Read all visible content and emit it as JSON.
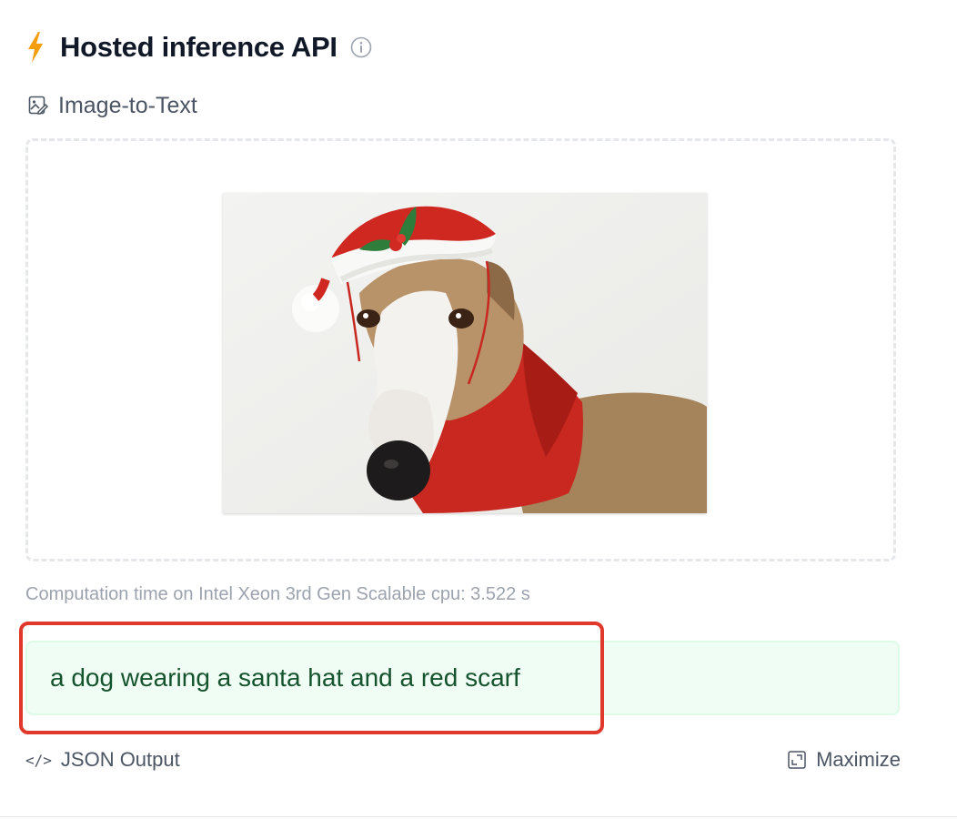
{
  "header": {
    "title": "Hosted inference API",
    "icon": "bolt-icon",
    "accent_color": "#f59e0b"
  },
  "task": {
    "label": "Image-to-Text",
    "icon": "image-to-text-icon"
  },
  "dropzone": {
    "image_description_icon": "image-preview"
  },
  "computation": {
    "text": "Computation time on Intel Xeon 3rd Gen Scalable cpu: 3.522 s"
  },
  "output": {
    "text": "a dog wearing a santa hat and a red scarf",
    "highlight_color": "#e0382b"
  },
  "footer": {
    "json_label": "JSON Output",
    "maximize_label": "Maximize"
  }
}
